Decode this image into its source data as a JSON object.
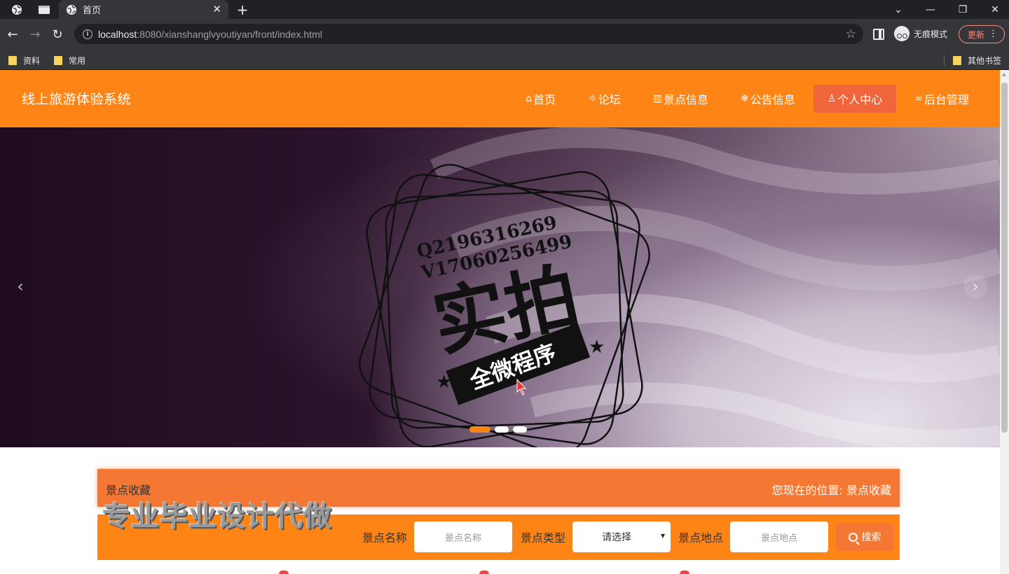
{
  "browser": {
    "tab_title": "首页",
    "url_host": "localhost",
    "url_rest": ":8080/xianshanglvyoutiyan/front/index.html",
    "incognito_label": "无痕模式",
    "update_label": "更新",
    "bookmarks": [
      "资料",
      "常用"
    ],
    "other_bookmarks": "其他书签"
  },
  "site": {
    "title": "线上旅游体验系统",
    "nav": [
      {
        "icon": "⌂",
        "label": "首页"
      },
      {
        "icon": "☼",
        "label": "论坛"
      },
      {
        "icon": "▥",
        "label": "景点信息"
      },
      {
        "icon": "❄",
        "label": "公告信息"
      },
      {
        "icon": "♙",
        "label": "个人中心"
      },
      {
        "icon": "∞",
        "label": "后台管理"
      }
    ],
    "active_nav": "个人中心"
  },
  "banner": {
    "stamp_line1": "Q2196316269",
    "stamp_line2": "V17060256499",
    "stamp_big": "实拍",
    "stamp_ribbon": "全微程序",
    "slides": 3,
    "active_slide": 1
  },
  "breadcrumb": {
    "title": "景点收藏",
    "position_label": "您现在的位置:",
    "position_value": "景点收藏"
  },
  "overlay_text": "专业毕业设计代做",
  "search": {
    "name_label": "景点名称",
    "name_placeholder": "景点名称",
    "type_label": "景点类型",
    "type_value": "请选择",
    "location_label": "景点地点",
    "location_placeholder": "景点地点",
    "button_label": "搜索"
  },
  "colors": {
    "header": "#fd8415",
    "active_nav": "#f1653c",
    "breadcrumb": "#f47834"
  }
}
